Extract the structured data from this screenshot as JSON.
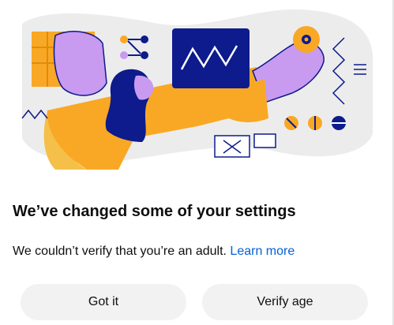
{
  "dialog": {
    "title": "We’ve changed some of your settings",
    "message": "We couldn’t verify that you’re an adult.",
    "link_label": "Learn more",
    "buttons": {
      "got_it": "Got it",
      "verify_age": "Verify age"
    }
  },
  "colors": {
    "illustration_bg": "#ececec",
    "orange": "#f9a825",
    "purple": "#c89af0",
    "navy": "#0d1b8c",
    "link": "#065fd4",
    "button_bg": "#f2f2f2"
  }
}
